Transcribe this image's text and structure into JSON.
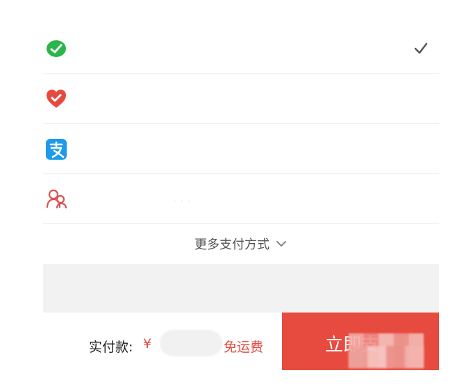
{
  "payment": {
    "methods": [
      {
        "icon": "wechat-pay-icon",
        "label": "",
        "selected": true
      },
      {
        "icon": "heart-pay-icon",
        "label": "",
        "selected": false
      },
      {
        "icon": "alipay-icon",
        "label": "",
        "selected": false
      },
      {
        "icon": "family-pay-icon",
        "label": "",
        "selected": false
      }
    ],
    "more_label": "更多支付方式",
    "more_chevron": "chevron-down-icon",
    "faint_text": "· · ·"
  },
  "checkout": {
    "pay_label": "实付款:",
    "currency": "¥",
    "shipping": "免运费",
    "buy_label": "立即支"
  },
  "colors": {
    "accent": "#e74a3f",
    "wechat": "#2ab64a",
    "heart": "#e64a3f",
    "alipay": "#1d9bea"
  }
}
